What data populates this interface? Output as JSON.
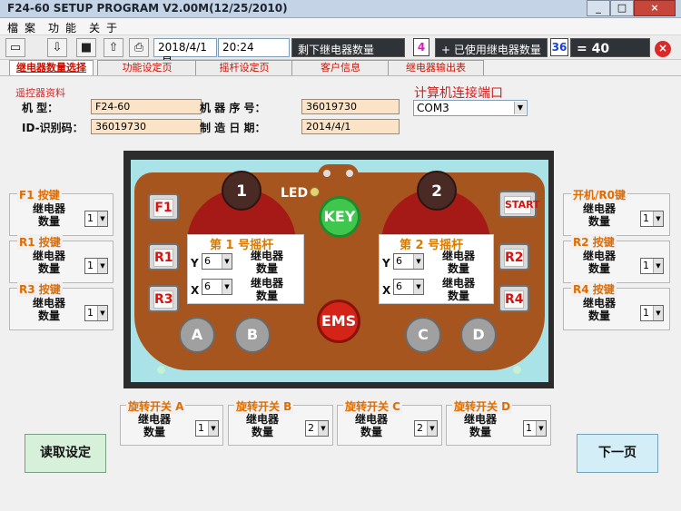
{
  "window": {
    "title": "F24-60 SETUP PROGRAM V2.00M(12/25/2010)",
    "minimize": "_",
    "maximize": "□",
    "close": "×"
  },
  "menu": [
    "檔",
    "案",
    "功",
    "能",
    "关",
    "于"
  ],
  "toolbar": {
    "date": "2018/4/1",
    "weekday": "星",
    "time": "20:24",
    "remain_label": "剩下继电器数量",
    "remain_value": "4",
    "used_label": "+ 已使用继电器数量",
    "used_value": "36",
    "total_label": "= 40"
  },
  "tabs": [
    "继电器数量选择",
    "功能设定页",
    "摇杆设定页",
    "客户信息",
    "继电器输出表"
  ],
  "info": {
    "section_title": "遥控器资料",
    "model_label": "机    型：",
    "model_value": "F24-60",
    "serial_label": "机 器 序 号：",
    "serial_value": "36019730",
    "id_label": "ID-识别码：",
    "id_value": "36019730",
    "date_label": "制 造 日 期：",
    "date_value": "2014/4/1",
    "port_title": "计算机连接端口",
    "port_value": "COM3"
  },
  "left_groups": [
    {
      "title": "F1 按键",
      "relay": "继电器",
      "count": "数量",
      "value": "1"
    },
    {
      "title": "R1 按键",
      "relay": "继电器",
      "count": "数量",
      "value": "1"
    },
    {
      "title": "R3 按键",
      "relay": "继电器",
      "count": "数量",
      "value": "1"
    }
  ],
  "right_groups": [
    {
      "title": "开机/R0键",
      "relay": "继电器",
      "count": "数量",
      "value": "1"
    },
    {
      "title": "R2 按键",
      "relay": "继电器",
      "count": "数量",
      "value": "1"
    },
    {
      "title": "R4 按键",
      "relay": "继电器",
      "count": "数量",
      "value": "1"
    }
  ],
  "bottom_groups": [
    {
      "title": "旋转开关 A",
      "relay": "继电器",
      "count": "数量",
      "value": "1"
    },
    {
      "title": "旋转开关 B",
      "relay": "继电器",
      "count": "数量",
      "value": "2"
    },
    {
      "title": "旋转开关 C",
      "relay": "继电器",
      "count": "数量",
      "value": "2"
    },
    {
      "title": "旋转开关 D",
      "relay": "继电器",
      "count": "数量",
      "value": "1"
    }
  ],
  "controller": {
    "led": "LED",
    "key": "KEY",
    "ems": "EMS",
    "start": "START",
    "btn_f1": "F1",
    "btn_r1": "R1",
    "btn_r3": "R3",
    "btn_r2": "R2",
    "btn_r4": "R4",
    "btn_a": "A",
    "btn_b": "B",
    "btn_c": "C",
    "btn_d": "D",
    "joy1": "1",
    "joy2": "2"
  },
  "joysticks": [
    {
      "title": "第 1 号摇杆",
      "y_label": "Y",
      "y_value": "6",
      "x_label": "X",
      "x_value": "6",
      "relay1": "继电器",
      "count1": "数量",
      "relay2": "继电器",
      "count2": "数量"
    },
    {
      "title": "第 2 号摇杆",
      "y_label": "Y",
      "y_value": "6",
      "x_label": "X",
      "x_value": "6",
      "relay1": "继电器",
      "count1": "数量",
      "relay2": "继电器",
      "count2": "数量"
    }
  ],
  "buttons": {
    "read": "读取设定",
    "next": "下一页"
  }
}
